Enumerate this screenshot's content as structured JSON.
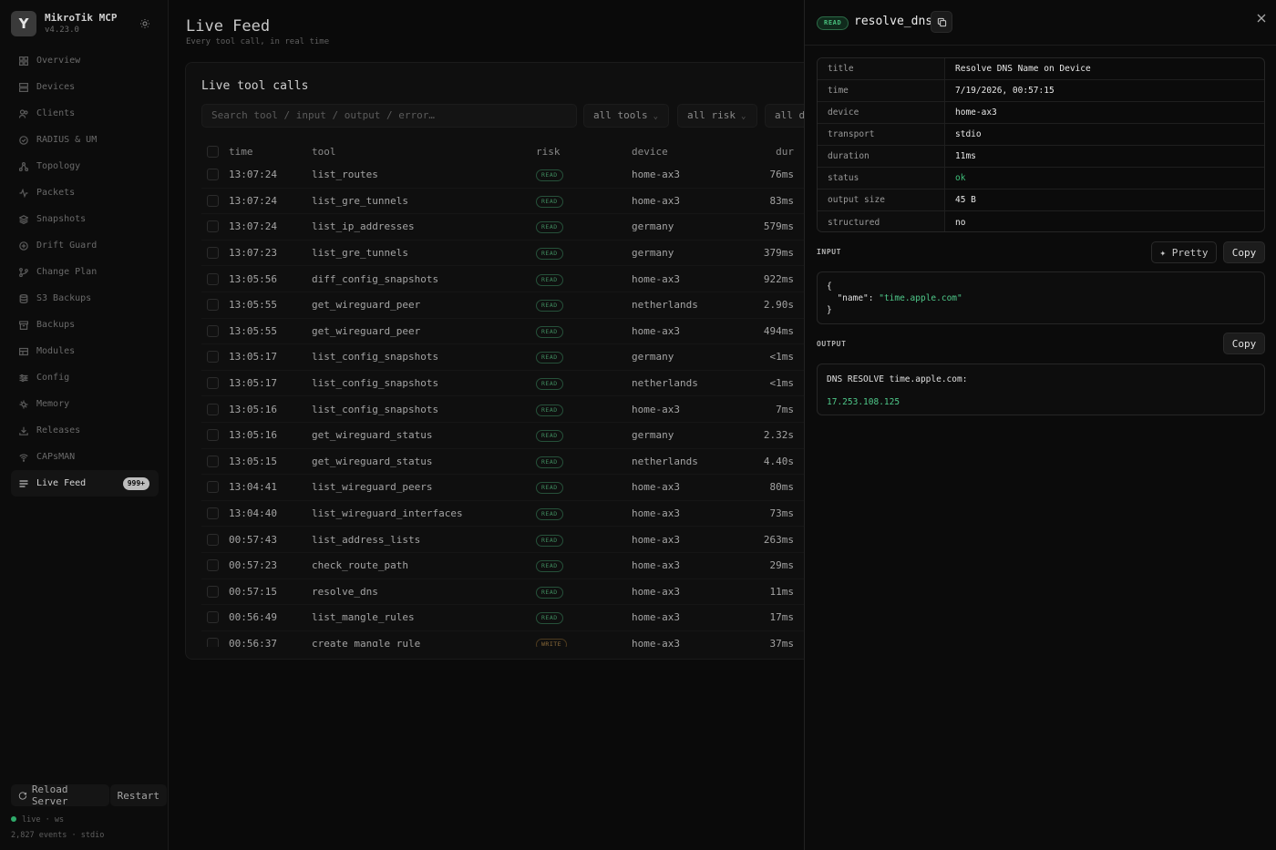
{
  "sidebar": {
    "app_name": "MikroTik MCP",
    "version": "v4.23.0",
    "items": [
      {
        "label": "Overview",
        "icon": "grid-icon"
      },
      {
        "label": "Devices",
        "icon": "server-icon"
      },
      {
        "label": "Clients",
        "icon": "users-icon"
      },
      {
        "label": "RADIUS & UM",
        "icon": "shield-icon"
      },
      {
        "label": "Topology",
        "icon": "topology-icon"
      },
      {
        "label": "Packets",
        "icon": "activity-icon"
      },
      {
        "label": "Snapshots",
        "icon": "layers-icon"
      },
      {
        "label": "Drift Guard",
        "icon": "drift-icon"
      },
      {
        "label": "Change Plan",
        "icon": "git-branch-icon"
      },
      {
        "label": "S3 Backups",
        "icon": "database-icon"
      },
      {
        "label": "Backups",
        "icon": "archive-icon"
      },
      {
        "label": "Modules",
        "icon": "modules-icon"
      },
      {
        "label": "Config",
        "icon": "sliders-icon"
      },
      {
        "label": "Memory",
        "icon": "memory-icon"
      },
      {
        "label": "Releases",
        "icon": "download-icon"
      },
      {
        "label": "CAPsMAN",
        "icon": "wifi-icon"
      },
      {
        "label": "Live Feed",
        "icon": "list-icon",
        "active": true,
        "badge": "999+"
      }
    ],
    "reload_label": "Reload Server",
    "restart_label": "Restart",
    "status_line": "live · ws",
    "events_line": "2,827 events · stdio"
  },
  "main": {
    "title": "Live Feed",
    "subtitle": "Every tool call, in real time",
    "panel_title": "Live tool calls",
    "search_placeholder": "Search tool / input / output / error…",
    "filters": [
      "all tools",
      "all risk",
      "all d"
    ],
    "columns": {
      "time": "time",
      "tool": "tool",
      "risk": "risk",
      "device": "device",
      "dur": "dur"
    },
    "rows": [
      {
        "time": "13:07:24",
        "tool": "list_routes",
        "risk": "READ",
        "device": "home-ax3",
        "dur": "76ms"
      },
      {
        "time": "13:07:24",
        "tool": "list_gre_tunnels",
        "risk": "READ",
        "device": "home-ax3",
        "dur": "83ms"
      },
      {
        "time": "13:07:24",
        "tool": "list_ip_addresses",
        "risk": "READ",
        "device": "germany",
        "dur": "579ms"
      },
      {
        "time": "13:07:23",
        "tool": "list_gre_tunnels",
        "risk": "READ",
        "device": "germany",
        "dur": "379ms"
      },
      {
        "time": "13:05:56",
        "tool": "diff_config_snapshots",
        "risk": "READ",
        "device": "home-ax3",
        "dur": "922ms"
      },
      {
        "time": "13:05:55",
        "tool": "get_wireguard_peer",
        "risk": "READ",
        "device": "netherlands",
        "dur": "2.90s"
      },
      {
        "time": "13:05:55",
        "tool": "get_wireguard_peer",
        "risk": "READ",
        "device": "home-ax3",
        "dur": "494ms"
      },
      {
        "time": "13:05:17",
        "tool": "list_config_snapshots",
        "risk": "READ",
        "device": "germany",
        "dur": "<1ms"
      },
      {
        "time": "13:05:17",
        "tool": "list_config_snapshots",
        "risk": "READ",
        "device": "netherlands",
        "dur": "<1ms"
      },
      {
        "time": "13:05:16",
        "tool": "list_config_snapshots",
        "risk": "READ",
        "device": "home-ax3",
        "dur": "7ms"
      },
      {
        "time": "13:05:16",
        "tool": "get_wireguard_status",
        "risk": "READ",
        "device": "germany",
        "dur": "2.32s"
      },
      {
        "time": "13:05:15",
        "tool": "get_wireguard_status",
        "risk": "READ",
        "device": "netherlands",
        "dur": "4.40s"
      },
      {
        "time": "13:04:41",
        "tool": "list_wireguard_peers",
        "risk": "READ",
        "device": "home-ax3",
        "dur": "80ms"
      },
      {
        "time": "13:04:40",
        "tool": "list_wireguard_interfaces",
        "risk": "READ",
        "device": "home-ax3",
        "dur": "73ms"
      },
      {
        "time": "00:57:43",
        "tool": "list_address_lists",
        "risk": "READ",
        "device": "home-ax3",
        "dur": "263ms"
      },
      {
        "time": "00:57:23",
        "tool": "check_route_path",
        "risk": "READ",
        "device": "home-ax3",
        "dur": "29ms"
      },
      {
        "time": "00:57:15",
        "tool": "resolve_dns",
        "risk": "READ",
        "device": "home-ax3",
        "dur": "11ms"
      },
      {
        "time": "00:56:49",
        "tool": "list_mangle_rules",
        "risk": "READ",
        "device": "home-ax3",
        "dur": "17ms"
      },
      {
        "time": "00:56:37",
        "tool": "create_mangle_rule",
        "risk": "WRITE",
        "device": "home-ax3",
        "dur": "37ms"
      }
    ]
  },
  "drawer": {
    "badge": "READ",
    "title": "resolve_dns",
    "details": [
      {
        "key": "title",
        "value": "Resolve DNS Name on Device"
      },
      {
        "key": "time",
        "value": "7/19/2026, 00:57:15"
      },
      {
        "key": "device",
        "value": "home-ax3"
      },
      {
        "key": "transport",
        "value": "stdio"
      },
      {
        "key": "duration",
        "value": "11ms"
      },
      {
        "key": "status",
        "value": "ok"
      },
      {
        "key": "output size",
        "value": "45 B"
      },
      {
        "key": "structured",
        "value": "no"
      }
    ],
    "input_label": "INPUT",
    "pretty_label": "✦ Pretty",
    "copy_label": "Copy",
    "input_open": "{",
    "input_key": "\"name\"",
    "input_colon": ": ",
    "input_value": "\"time.apple.com\"",
    "input_close": "}",
    "output_label": "OUTPUT",
    "output_copy_label": "Copy",
    "output_line1": "DNS RESOLVE time.apple.com:",
    "output_line2": "17.253.108.125",
    "accent_green": "#3fbf7a"
  }
}
